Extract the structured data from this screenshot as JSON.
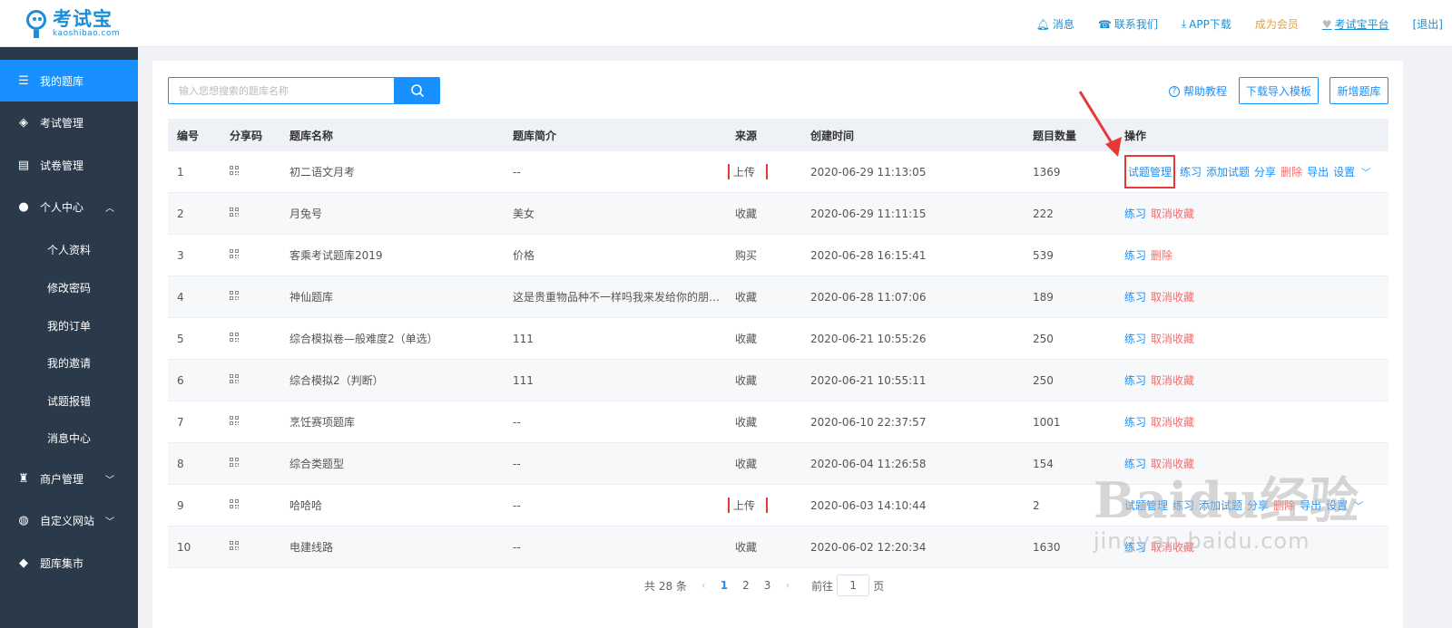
{
  "header": {
    "logo_title": "考试宝",
    "logo_sub": "kaoshibao.com",
    "nav": {
      "messages": "消息",
      "contact": "联系我们",
      "app": "APP下载",
      "member": "成为会员",
      "platform": "考试宝平台",
      "logout": "[退出]"
    }
  },
  "sidebar": {
    "items": [
      {
        "label": "我的题库",
        "icon": "database-icon"
      },
      {
        "label": "考试管理",
        "icon": "layers-icon"
      },
      {
        "label": "试卷管理",
        "icon": "paper-icon"
      },
      {
        "label": "个人中心",
        "icon": "user-icon"
      },
      {
        "label": "商户管理",
        "icon": "bag-icon"
      },
      {
        "label": "自定义网站",
        "icon": "globe-icon"
      },
      {
        "label": "题库集市",
        "icon": "cube-icon"
      }
    ],
    "sub_items": [
      "个人资料",
      "修改密码",
      "我的订单",
      "我的邀请",
      "试题报错",
      "消息中心"
    ]
  },
  "toolbar": {
    "search_placeholder": "输入您想搜索的题库名称",
    "help": "帮助教程",
    "download_template": "下载导入模板",
    "new_bank": "新增题库"
  },
  "table": {
    "headers": [
      "编号",
      "分享码",
      "题库名称",
      "题库简介",
      "来源",
      "创建时间",
      "题目数量",
      "操作"
    ],
    "rows": [
      {
        "id": "1",
        "name": "初二语文月考",
        "desc": "--",
        "source": "上传",
        "time": "2020-06-29 11:13:05",
        "count": "1369",
        "ops": [
          "试题管理",
          "练习",
          "添加试题",
          "分享",
          "删除",
          "导出",
          "设置"
        ]
      },
      {
        "id": "2",
        "name": "月兔号",
        "desc": "美女",
        "source": "收藏",
        "time": "2020-06-29 11:11:15",
        "count": "222",
        "ops": [
          "练习",
          "取消收藏"
        ]
      },
      {
        "id": "3",
        "name": "客乘考试题库2019",
        "desc": "价格",
        "source": "购买",
        "time": "2020-06-28 16:15:41",
        "count": "539",
        "ops": [
          "练习",
          "删除"
        ]
      },
      {
        "id": "4",
        "name": "神仙题库",
        "desc": "这是贵重物品种不一样吗我来发给你的朋…",
        "source": "收藏",
        "time": "2020-06-28 11:07:06",
        "count": "189",
        "ops": [
          "练习",
          "取消收藏"
        ]
      },
      {
        "id": "5",
        "name": "综合模拟卷—般难度2（单选）",
        "desc": "111",
        "source": "收藏",
        "time": "2020-06-21 10:55:26",
        "count": "250",
        "ops": [
          "练习",
          "取消收藏"
        ]
      },
      {
        "id": "6",
        "name": "综合模拟2（判断）",
        "desc": "111",
        "source": "收藏",
        "time": "2020-06-21 10:55:11",
        "count": "250",
        "ops": [
          "练习",
          "取消收藏"
        ]
      },
      {
        "id": "7",
        "name": "烹饪赛项题库",
        "desc": "--",
        "source": "收藏",
        "time": "2020-06-10 22:37:57",
        "count": "1001",
        "ops": [
          "练习",
          "取消收藏"
        ]
      },
      {
        "id": "8",
        "name": "综合类题型",
        "desc": "--",
        "source": "收藏",
        "time": "2020-06-04 11:26:58",
        "count": "154",
        "ops": [
          "练习",
          "取消收藏"
        ]
      },
      {
        "id": "9",
        "name": "哈哈哈",
        "desc": "--",
        "source": "上传",
        "time": "2020-06-03 14:10:44",
        "count": "2",
        "ops": [
          "试题管理",
          "练习",
          "添加试题",
          "分享",
          "删除",
          "导出",
          "设置"
        ]
      },
      {
        "id": "10",
        "name": "电建线路",
        "desc": "--",
        "source": "收藏",
        "time": "2020-06-02 12:20:34",
        "count": "1630",
        "ops": [
          "练习",
          "取消收藏"
        ]
      }
    ]
  },
  "pager": {
    "total": "共 28 条",
    "pages": [
      "1",
      "2",
      "3"
    ],
    "goto_prefix": "前往",
    "goto_value": "1",
    "goto_suffix": "页"
  },
  "watermark": {
    "main": "Baidu经验",
    "sub": "jingyan.baidu.com"
  },
  "colors": {
    "primary": "#1890ff",
    "sidebar_bg": "#2b3a4a",
    "danger": "#f56c6c",
    "member": "#e6a23c",
    "highlight": "#e53935"
  }
}
